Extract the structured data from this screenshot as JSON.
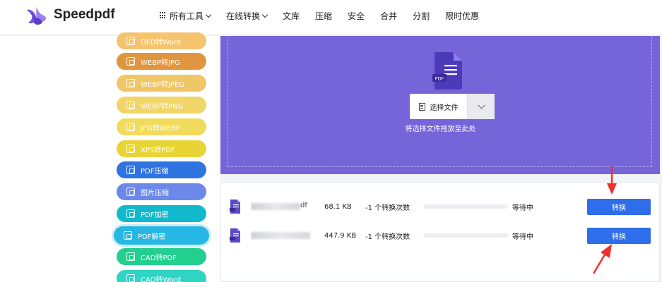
{
  "header": {
    "brand": "Speedpdf",
    "nav": [
      {
        "label": "所有工具",
        "has_grid": true,
        "has_chevron": true
      },
      {
        "label": "在线转换",
        "has_grid": false,
        "has_chevron": true
      },
      {
        "label": "文库"
      },
      {
        "label": "压缩"
      },
      {
        "label": "安全"
      },
      {
        "label": "合并"
      },
      {
        "label": "分割"
      },
      {
        "label": "限时优惠"
      }
    ]
  },
  "sidebar": {
    "items": [
      {
        "label": "OFD转Word",
        "color": "#f6c46e"
      },
      {
        "label": "WEBP转JPG",
        "color": "#e2953f"
      },
      {
        "label": "WEBP转JPEG",
        "color": "#f0c667"
      },
      {
        "label": "WEBP转PNG",
        "color": "#f1d566"
      },
      {
        "label": "JPG转WEBP",
        "color": "#f1db5c"
      },
      {
        "label": "XPS转PDF",
        "color": "#e8d535"
      },
      {
        "label": "PDF压缩",
        "color": "#2f74e0"
      },
      {
        "label": "图片压缩",
        "color": "#6c88ea"
      },
      {
        "label": "PDF加密",
        "color": "#12b9cc"
      },
      {
        "label": "PDF解密",
        "color": "#27b7e4",
        "active": true
      },
      {
        "label": "CAD转PDF",
        "color": "#23cf8f"
      },
      {
        "label": "CAD转Word",
        "color": "#2fd4c4"
      }
    ]
  },
  "upload": {
    "file_icon_label": "PDF",
    "choose_label": "选择文件",
    "drop_hint": "将选择文件拖放至此处",
    "bg_color": "#7565d9"
  },
  "files": [
    {
      "name_suffix": "df",
      "size": "68.1 KB",
      "count": "-1 个转换次数",
      "status": "等待中",
      "action": "转换",
      "progress": 0
    },
    {
      "name_suffix": "",
      "size": "447.9 KB",
      "count": "-1 个转换次数",
      "status": "等待中",
      "action": "转换",
      "progress": 0
    }
  ],
  "accent": "#2f6eea",
  "annotation_color": "#f0302c"
}
